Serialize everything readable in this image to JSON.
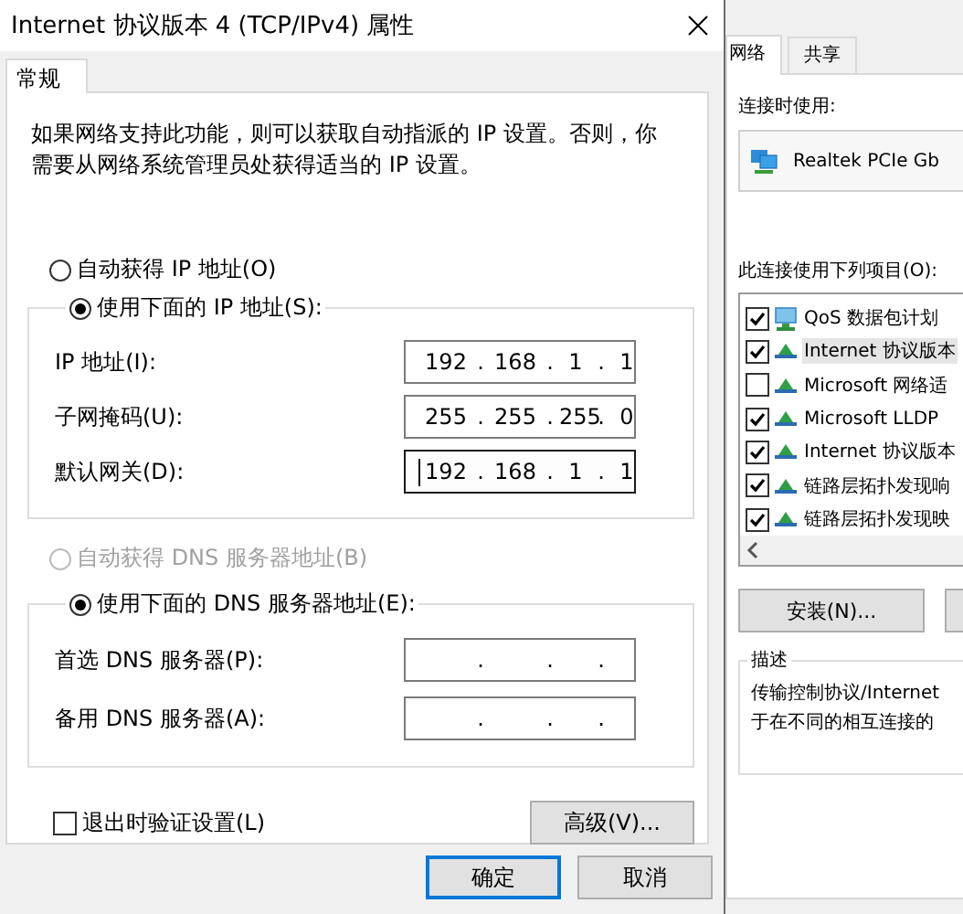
{
  "dialog": {
    "title": "Internet 协议版本 4 (TCP/IPv4) 属性",
    "tabs": [
      {
        "label": "常规",
        "selected": true
      }
    ],
    "description": "如果网络支持此功能，则可以获取自动指派的 IP 设置。否则，你需要从网络系统管理员处获得适当的 IP 设置。",
    "ip_options": [
      {
        "label": "自动获得 IP 地址(O)",
        "selected": false,
        "disabled": false
      },
      {
        "label": "使用下面的 IP 地址(S):",
        "selected": true,
        "disabled": false
      }
    ],
    "ip_fields": [
      {
        "label": "IP 地址(I):",
        "octets": [
          "192",
          "168",
          "1",
          "1"
        ],
        "focused": false
      },
      {
        "label": "子网掩码(U):",
        "octets": [
          "255",
          "255",
          "255",
          "0"
        ],
        "focused": false
      },
      {
        "label": "默认网关(D):",
        "octets": [
          "192",
          "168",
          "1",
          "1"
        ],
        "focused": true
      }
    ],
    "dns_options": [
      {
        "label": "自动获得 DNS 服务器地址(B)",
        "selected": false,
        "disabled": true
      },
      {
        "label": "使用下面的 DNS 服务器地址(E):",
        "selected": true,
        "disabled": false
      }
    ],
    "dns_fields": [
      {
        "label": "首选 DNS 服务器(P):",
        "focused": false
      },
      {
        "label": "备用 DNS 服务器(A):",
        "focused": false
      }
    ],
    "separator": ".",
    "validate": {
      "label": "退出时验证设置(L)",
      "checked": false
    },
    "advanced_button": "高级(V)...",
    "buttons": [
      {
        "label": "确定",
        "default": true
      },
      {
        "label": "取消",
        "default": false
      }
    ]
  },
  "background_window": {
    "tabs": [
      {
        "label": "网络",
        "selected": true
      },
      {
        "label": "共享",
        "selected": false
      }
    ],
    "connect_using_label": "连接时使用:",
    "adapter": "Realtek PCIe Gb",
    "items_label": "此连接使用下列项目(O):",
    "items": [
      {
        "label": "QoS 数据包计划",
        "checked": true,
        "selected": false,
        "kind": "service"
      },
      {
        "label": "Internet 协议版本",
        "checked": true,
        "selected": true,
        "kind": "protocol"
      },
      {
        "label": "Microsoft 网络适",
        "checked": false,
        "selected": false,
        "kind": "protocol"
      },
      {
        "label": "Microsoft LLDP",
        "checked": true,
        "selected": false,
        "kind": "protocol"
      },
      {
        "label": "Internet 协议版本",
        "checked": true,
        "selected": false,
        "kind": "protocol"
      },
      {
        "label": "链路层拓扑发现响",
        "checked": true,
        "selected": false,
        "kind": "protocol"
      },
      {
        "label": "链路层拓扑发现映",
        "checked": true,
        "selected": false,
        "kind": "protocol"
      }
    ],
    "install_button": "安装(N)...",
    "description_title": "描述",
    "description_lines": [
      "传输控制协议/Internet",
      "于在不同的相互连接的"
    ]
  }
}
